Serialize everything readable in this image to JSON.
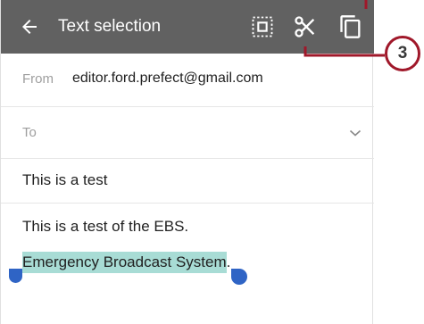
{
  "toolbar": {
    "title": "Text selection",
    "icons": [
      "back-arrow-icon",
      "select-all-icon",
      "cut-icon",
      "copy-icon"
    ],
    "background_color": "#616161"
  },
  "compose": {
    "from_label": "From",
    "from_value": "editor.ford.prefect@gmail.com",
    "to_label": "To",
    "subject": "This is a test",
    "body_line1": "This is a test of the EBS.",
    "body_line2_selected": "Emergency Broadcast System",
    "body_line2_rest": ".",
    "selection_color": "#a8dcd5",
    "handle_color": "#2f64c5"
  },
  "callout": {
    "number": "3",
    "color": "#a0182a"
  }
}
